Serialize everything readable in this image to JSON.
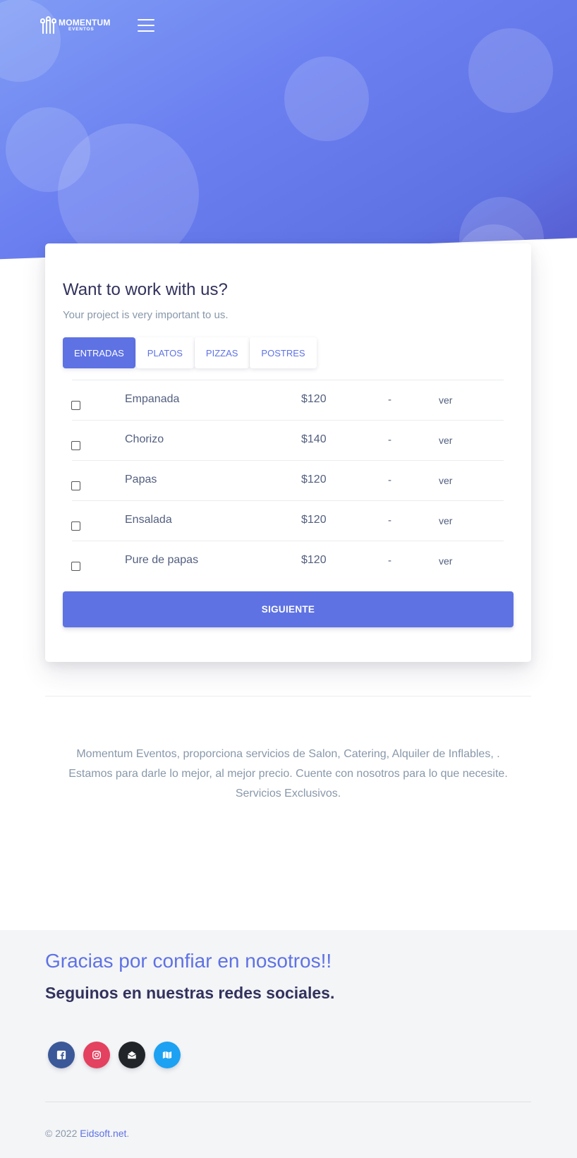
{
  "brand": {
    "name": "MOMENTUM",
    "sub": "EVENTOS"
  },
  "card": {
    "title": "Want to work with us?",
    "subtitle": "Your project is very important to us.",
    "tabs": [
      {
        "label": "ENTRADAS",
        "active": true
      },
      {
        "label": "PLATOS",
        "active": false
      },
      {
        "label": "PIZZAS",
        "active": false
      },
      {
        "label": "POSTRES",
        "active": false
      }
    ],
    "rows": [
      {
        "name": "Empanada",
        "price": "$120",
        "dash": "-",
        "link": "ver"
      },
      {
        "name": "Chorizo",
        "price": "$140",
        "dash": "-",
        "link": "ver"
      },
      {
        "name": "Papas",
        "price": "$120",
        "dash": "-",
        "link": "ver"
      },
      {
        "name": "Ensalada",
        "price": "$120",
        "dash": "-",
        "link": "ver"
      },
      {
        "name": "Pure de papas",
        "price": "$120",
        "dash": "-",
        "link": "ver"
      }
    ],
    "button": "SIGUIENTE"
  },
  "about": {
    "line1": "Momentum Eventos, proporciona servicios de Salon, Catering, Alquiler de Inflables, .",
    "line2": "Estamos para darle lo mejor, al mejor precio. Cuente con nosotros para lo que necesite.",
    "line3": "Servicios Exclusivos."
  },
  "footer": {
    "thanks": "Gracias por confiar en nosotros!!",
    "follow": "Seguinos en nuestras redes sociales.",
    "socials": [
      {
        "icon": "facebook-icon",
        "color": "#3b5998"
      },
      {
        "icon": "instagram-icon",
        "color": "#e4405f"
      },
      {
        "icon": "envelope-open-icon",
        "color": "#212529"
      },
      {
        "icon": "map-icon",
        "color": "#1da1f2"
      }
    ],
    "copy_prefix": "© 2022 ",
    "copy_link": "Eidsoft.net",
    "copy_suffix": "."
  },
  "colors": {
    "primary": "#5e72e4",
    "heading": "#32325d",
    "muted": "#8898aa"
  }
}
